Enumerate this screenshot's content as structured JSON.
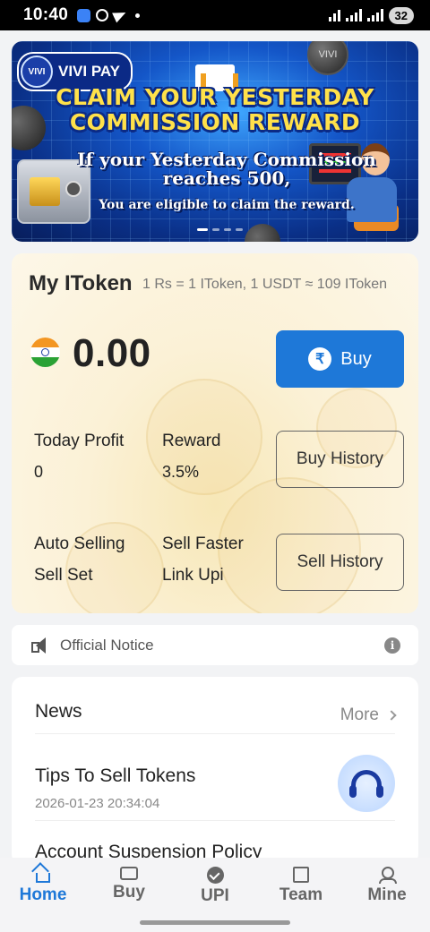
{
  "status_bar": {
    "time": "10:40",
    "battery": "32"
  },
  "banner": {
    "logo_text": "VIVI PAY",
    "logo_mark": "VIVI",
    "coin_label": "VIVI",
    "title_line1": "CLAIM YOUR YESTERDAY",
    "title_line2": "COMMISSION REWARD",
    "sub_line1": "If your Yesterday Commission",
    "sub_line2": "reaches 500,",
    "sub_line3": "You are eligible to claim the reward."
  },
  "itoken": {
    "title": "My IToken",
    "rate": "1 Rs = 1 IToken, 1 USDT ≈ 109 IToken",
    "balance": "0.00",
    "buy_label": "Buy",
    "currency_symbol": "₹",
    "today_profit_label": "Today Profit",
    "today_profit_value": "0",
    "reward_label": "Reward",
    "reward_value": "3.5%",
    "buy_history_label": "Buy History",
    "auto_selling_label": "Auto Selling",
    "sell_set_label": "Sell Set",
    "sell_faster_label": "Sell Faster",
    "link_upi_label": "Link Upi",
    "sell_history_label": "Sell History"
  },
  "notice": {
    "text": "Official Notice",
    "info_glyph": "i"
  },
  "news": {
    "title": "News",
    "more_label": "More",
    "items": [
      {
        "title": "Tips To Sell Tokens",
        "date": "2026-01-23 20:34:04"
      },
      {
        "title": "Account Suspension Policy",
        "date": ""
      }
    ]
  },
  "tabbar": {
    "tabs": [
      {
        "label": "Home",
        "active": true,
        "icon": "home-icon"
      },
      {
        "label": "Buy",
        "active": false,
        "icon": "ticket-icon"
      },
      {
        "label": "UPI",
        "active": false,
        "icon": "check-circle-icon"
      },
      {
        "label": "Team",
        "active": false,
        "icon": "edit-square-icon"
      },
      {
        "label": "Mine",
        "active": false,
        "icon": "user-icon"
      }
    ]
  },
  "colors": {
    "accent": "#1e78d8",
    "banner_title": "#ffe14a",
    "card_bg": "#fbf1d6"
  }
}
